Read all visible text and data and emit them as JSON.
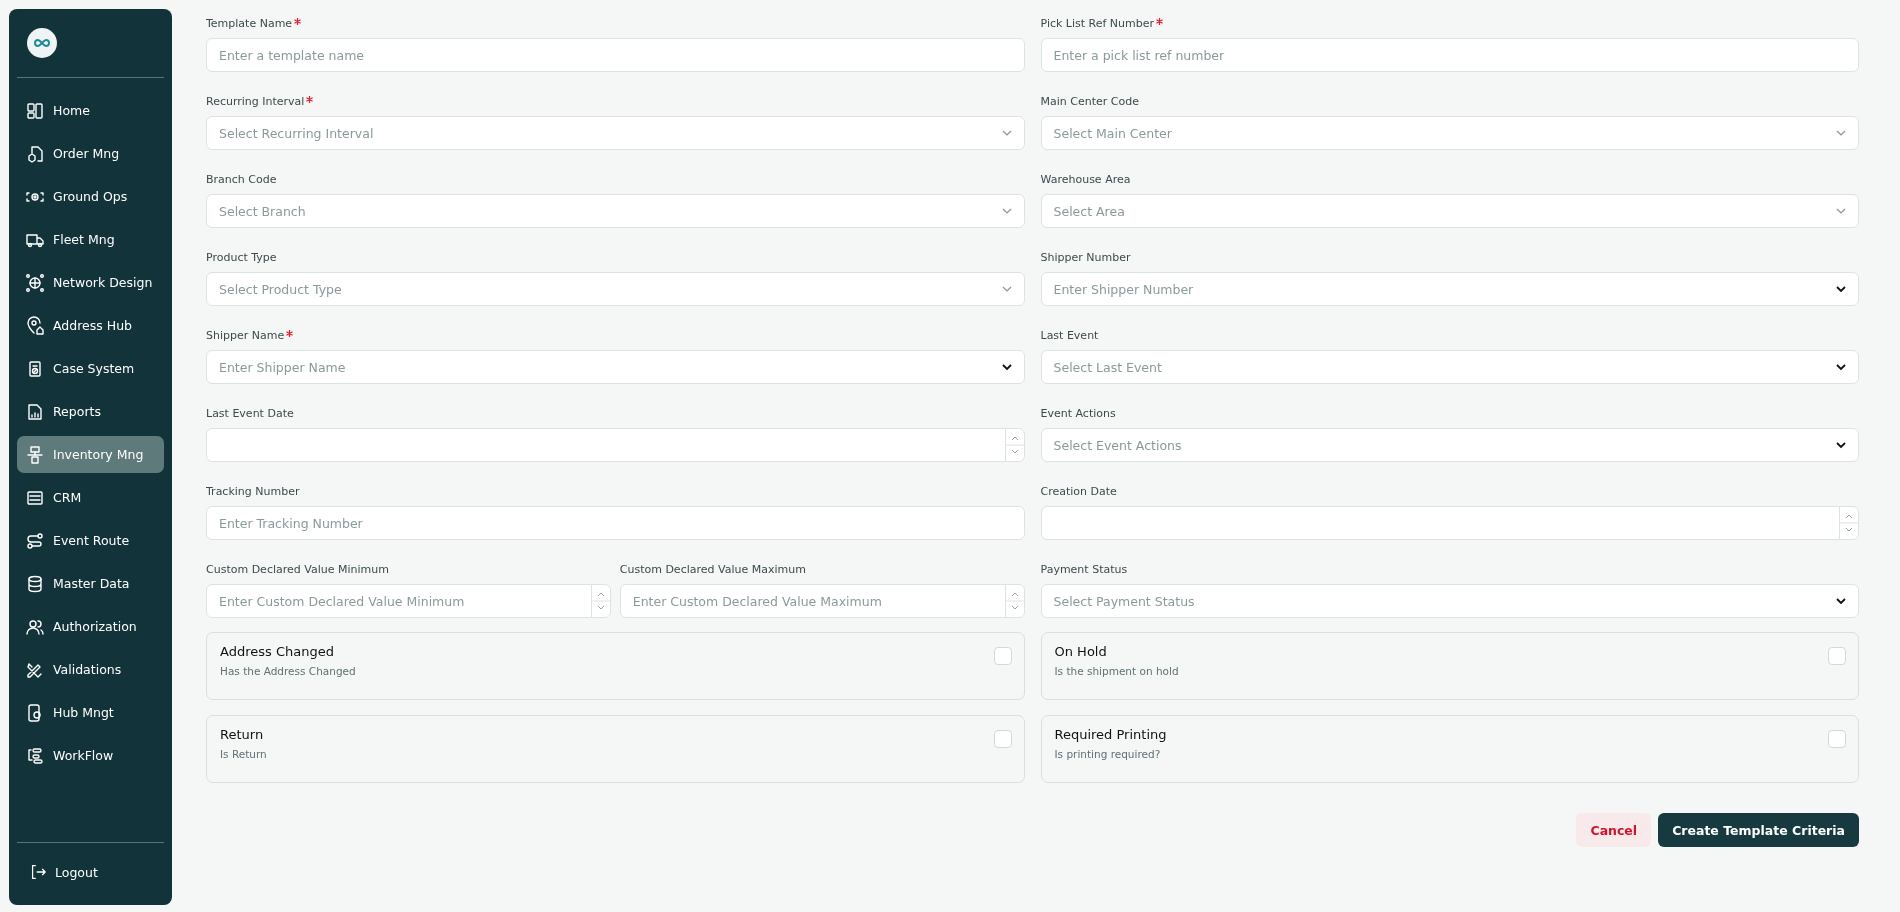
{
  "sidebar": {
    "items": [
      {
        "label": "Home",
        "selected": false
      },
      {
        "label": "Order Mng",
        "selected": false
      },
      {
        "label": "Ground Ops",
        "selected": false
      },
      {
        "label": "Fleet Mng",
        "selected": false
      },
      {
        "label": "Network Design",
        "selected": false
      },
      {
        "label": "Address Hub",
        "selected": false
      },
      {
        "label": "Case System",
        "selected": false
      },
      {
        "label": "Reports",
        "selected": false
      },
      {
        "label": "Inventory Mng",
        "selected": true
      },
      {
        "label": "CRM",
        "selected": false
      },
      {
        "label": "Event Route",
        "selected": false
      },
      {
        "label": "Master Data",
        "selected": false
      },
      {
        "label": "Authorization",
        "selected": false
      },
      {
        "label": "Validations",
        "selected": false
      },
      {
        "label": "Hub Mngt",
        "selected": false
      },
      {
        "label": "WorkFlow",
        "selected": false
      }
    ],
    "logout": "Logout"
  },
  "form": {
    "rows": [
      {
        "left": [
          {
            "kind": "text",
            "label": "Template Name",
            "required": true,
            "placeholder": "Enter a template name"
          }
        ],
        "right": [
          {
            "kind": "text",
            "label": "Pick List Ref Number",
            "required": true,
            "placeholder": "Enter a pick list ref number"
          }
        ]
      },
      {
        "left": [
          {
            "kind": "select",
            "label": "Recurring Interval",
            "required": true,
            "placeholder": "Select Recurring Interval"
          }
        ],
        "right": [
          {
            "kind": "select",
            "label": "Main Center Code",
            "required": false,
            "placeholder": "Select Main Center"
          }
        ]
      },
      {
        "left": [
          {
            "kind": "select",
            "label": "Branch Code",
            "required": false,
            "placeholder": "Select Branch"
          }
        ],
        "right": [
          {
            "kind": "select",
            "label": "Warehouse Area",
            "required": false,
            "placeholder": "Select Area"
          }
        ]
      },
      {
        "left": [
          {
            "kind": "select",
            "label": "Product Type",
            "required": false,
            "placeholder": "Select Product Type"
          }
        ],
        "right": [
          {
            "kind": "combo",
            "label": "Shipper Number",
            "required": false,
            "placeholder": "Enter Shipper Number"
          }
        ]
      },
      {
        "left": [
          {
            "kind": "combo",
            "label": "Shipper Name",
            "required": true,
            "placeholder": "Enter Shipper Name"
          }
        ],
        "right": [
          {
            "kind": "combo",
            "label": "Last Event",
            "required": false,
            "placeholder": "Select Last Event"
          }
        ]
      },
      {
        "left": [
          {
            "kind": "date",
            "label": "Last Event Date",
            "required": false
          }
        ],
        "right": [
          {
            "kind": "combo",
            "label": "Event Actions",
            "required": false,
            "placeholder": "Select Event Actions"
          }
        ]
      },
      {
        "left": [
          {
            "kind": "text",
            "label": "Tracking Number",
            "required": false,
            "placeholder": "Enter Tracking Number"
          }
        ],
        "right": [
          {
            "kind": "date",
            "label": "Creation Date",
            "required": false
          }
        ]
      },
      {
        "left": [
          {
            "kind": "number",
            "label": "Custom Declared Value Minimum",
            "required": false,
            "placeholder": "Enter Custom Declared Value Minimum"
          },
          {
            "kind": "number",
            "label": "Custom Declared Value Maximum",
            "required": false,
            "placeholder": "Enter Custom Declared Value Maximum"
          }
        ],
        "right": [
          {
            "kind": "combo",
            "label": "Payment Status",
            "required": false,
            "placeholder": "Select Payment Status"
          }
        ]
      }
    ],
    "options": [
      {
        "title": "Address Changed",
        "description": "Has the Address Changed",
        "checked": false
      },
      {
        "title": "On Hold",
        "description": "Is the shipment on hold",
        "checked": false
      },
      {
        "title": "Return",
        "description": "Is Return",
        "checked": false
      },
      {
        "title": "Required Printing",
        "description": "Is printing required?",
        "checked": false
      }
    ],
    "actions": [
      {
        "kind": "cancel",
        "label": "Cancel"
      },
      {
        "kind": "primary",
        "label": "Create Template Criteria"
      }
    ]
  }
}
